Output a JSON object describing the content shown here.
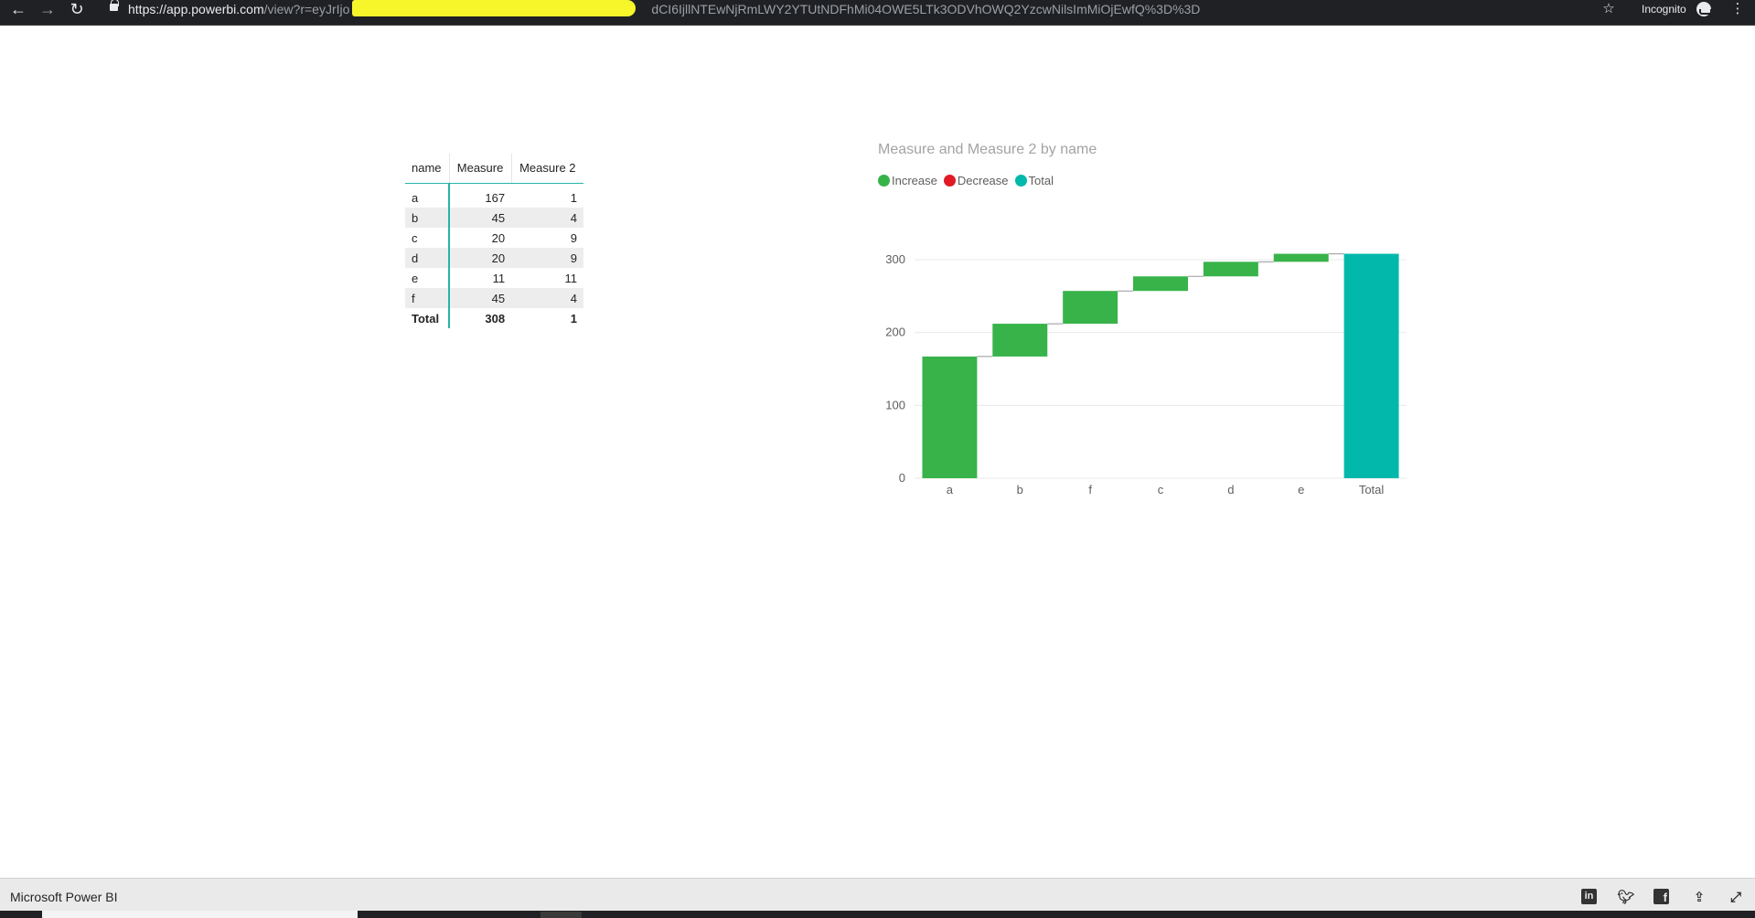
{
  "browser": {
    "url_host": "https://app.powerbi.com",
    "url_rest_visible_start": "/view?r=eyJrIjo",
    "url_rest_visible_end": "dCI6IjllNTEwNjRmLWY2YTUtNDFhMi04OWE5LTk3ODVhOWQ2YzcwNilsImMiOjEwfQ%3D%3D",
    "incognito_label": "Incognito",
    "back_icon": "back-arrow-icon",
    "forward_icon": "forward-arrow-icon",
    "reload_icon": "reload-icon",
    "star_icon": "bookmark-star-icon",
    "menu_icon": "kebab-menu-icon"
  },
  "table": {
    "headers": [
      "name",
      "Measure",
      "Measure 2"
    ],
    "rows": [
      [
        "a",
        "167",
        "1"
      ],
      [
        "b",
        "45",
        "4"
      ],
      [
        "c",
        "20",
        "9"
      ],
      [
        "d",
        "20",
        "9"
      ],
      [
        "e",
        "11",
        "11"
      ],
      [
        "f",
        "45",
        "4"
      ]
    ],
    "total": [
      "Total",
      "308",
      "1"
    ]
  },
  "chart": {
    "title": "Measure and Measure 2 by name",
    "legend": [
      {
        "label": "Increase",
        "color": "#37b34a"
      },
      {
        "label": "Decrease",
        "color": "#e01b24"
      },
      {
        "label": "Total",
        "color": "#01b8aa"
      }
    ]
  },
  "chart_data": {
    "type": "bar",
    "subtype": "waterfall",
    "title": "Measure and Measure 2 by name",
    "categories": [
      "a",
      "b",
      "f",
      "c",
      "d",
      "e",
      "Total"
    ],
    "values": [
      167,
      45,
      45,
      20,
      20,
      11,
      308
    ],
    "kinds": [
      "increase",
      "increase",
      "increase",
      "increase",
      "increase",
      "increase",
      "total"
    ],
    "yticks": [
      0,
      100,
      200,
      300
    ],
    "ylim": [
      0,
      320
    ],
    "xlabel": "",
    "ylabel": "",
    "grid": true,
    "legend_position": "top-left",
    "colors": {
      "increase": "#37b34a",
      "decrease": "#e01b24",
      "total": "#01b8aa"
    }
  },
  "footer": {
    "brand": "Microsoft Power BI",
    "linkedin_icon": "linkedin-icon",
    "twitter_icon": "twitter-icon",
    "facebook_icon": "facebook-icon",
    "share_icon": "share-icon",
    "fullscreen_icon": "fullscreen-icon"
  }
}
